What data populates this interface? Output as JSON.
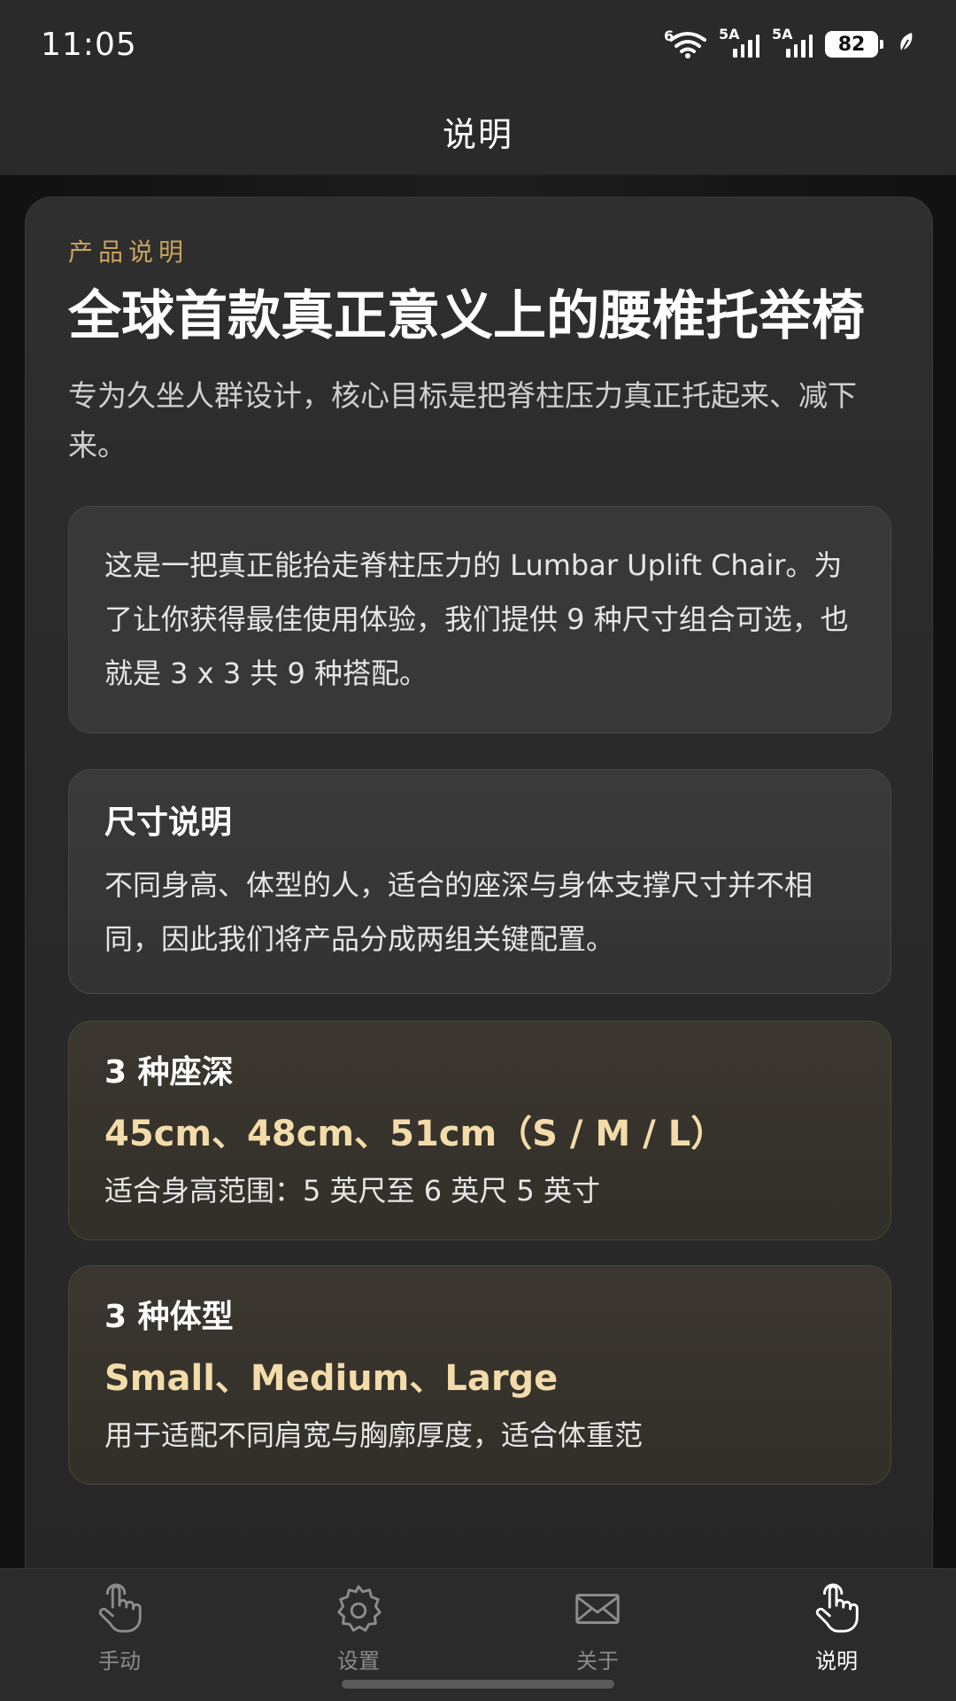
{
  "status_bar": {
    "time": "11:05",
    "wifi_label": "6",
    "sim1_label": "5A",
    "sim2_label": "5A",
    "battery": "82"
  },
  "header": {
    "title": "说明"
  },
  "intro": {
    "eyebrow": "产品说明",
    "headline": "全球首款真正意义上的腰椎托举椅",
    "subtitle": "专为久坐人群设计，核心目标是把脊柱压力真正托起来、减下来。"
  },
  "info_box": {
    "text": "这是一把真正能抬走脊柱压力的 Lumbar Uplift Chair。为了让你获得最佳使用体验，我们提供 9 种尺寸组合可选，也就是 3 x 3 共 9 种搭配。"
  },
  "size_section": {
    "title": "尺寸说明",
    "text": "不同身高、体型的人，适合的座深与身体支撑尺寸并不相同，因此我们将产品分成两组关键配置。"
  },
  "seat_depth": {
    "title": "3 种座深",
    "highlight": "45cm、48cm、51cm（S / M / L）",
    "text": "适合身高范围：5 英尺至 6 英尺 5 英寸"
  },
  "body_type": {
    "title": "3 种体型",
    "highlight": "Small、Medium、Large",
    "text": "用于适配不同肩宽与胸廓厚度，适合体重范"
  },
  "nav": {
    "items": [
      {
        "label": "手动",
        "icon": "hand-pointer-icon"
      },
      {
        "label": "设置",
        "icon": "gear-icon"
      },
      {
        "label": "关于",
        "icon": "envelope-icon"
      },
      {
        "label": "说明",
        "icon": "hand-pointer-icon"
      }
    ],
    "active_index": 3
  },
  "colors": {
    "accent_gold": "#c9a35e",
    "highlight_gold": "#f3dcaa",
    "background": "#181818"
  }
}
